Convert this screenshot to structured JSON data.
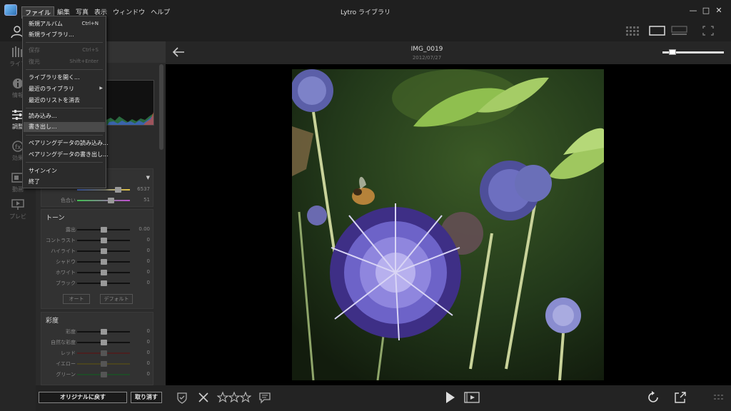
{
  "window": {
    "title": "Lytro ライブラリ",
    "minimize": "—",
    "maximize": "□",
    "close": "✕"
  },
  "menubar": [
    "ファイル",
    "編集",
    "写真",
    "表示",
    "ウィンドウ",
    "ヘルプ"
  ],
  "file_menu": {
    "new_album": "新規アルバム",
    "new_album_shortcut": "Ctrl+N",
    "new_library": "新規ライブラリ...",
    "save": "保存",
    "save_shortcut": "Ctrl+S",
    "restore": "復元",
    "restore_shortcut": "Shift+Enter",
    "open_library": "ライブラリを開く...",
    "recent_libraries": "最近のライブラリ",
    "clear_recent": "最近のリストを消去",
    "import": "読み込み...",
    "export": "書き出し...",
    "import_pairing": "ペアリングデータの読み込み...",
    "export_pairing": "ペアリングデータの書き出し...",
    "sign_in": "サインイン",
    "quit": "終了"
  },
  "leftnav": {
    "library": "ライブ",
    "info": "情報",
    "adjust": "調整",
    "effects": "効果",
    "animate": "動画",
    "preview": "プレビ"
  },
  "white_balance": {
    "temp_value": "6537",
    "tint_label": "色合い",
    "tint_value": "51",
    "temp_position": 0.77,
    "tint_position": 0.63
  },
  "tone": {
    "title": "トーン",
    "rows": [
      {
        "label": "露出",
        "value": "0.00",
        "position": 0.5
      },
      {
        "label": "コントラスト",
        "value": "0",
        "position": 0.5
      },
      {
        "label": "ハイライト",
        "value": "0",
        "position": 0.5
      },
      {
        "label": "シャドウ",
        "value": "0",
        "position": 0.5
      },
      {
        "label": "ホワイト",
        "value": "0",
        "position": 0.5
      },
      {
        "label": "ブラック",
        "value": "0",
        "position": 0.5
      }
    ],
    "auto": "オート",
    "default": "デフォルト"
  },
  "saturation": {
    "title": "彩度",
    "rows": [
      {
        "label": "彩度",
        "value": "0",
        "position": 0.5
      },
      {
        "label": "自然な彩度",
        "value": "0",
        "position": 0.5
      },
      {
        "label": "レッド",
        "value": "0",
        "position": 0.5
      },
      {
        "label": "イエロー",
        "value": "0",
        "position": 0.5
      },
      {
        "label": "グリーン",
        "value": "0",
        "position": 0.5
      }
    ]
  },
  "actions": {
    "revert": "オリジナルに戻す",
    "cancel": "取り消す"
  },
  "photo": {
    "title": "IMG_0019",
    "date": "2012/07/27",
    "zoom": 0.1
  },
  "colors": {
    "accent": "#6d63c8",
    "background": "#1e1e1e",
    "panel": "#2b2b2b"
  }
}
